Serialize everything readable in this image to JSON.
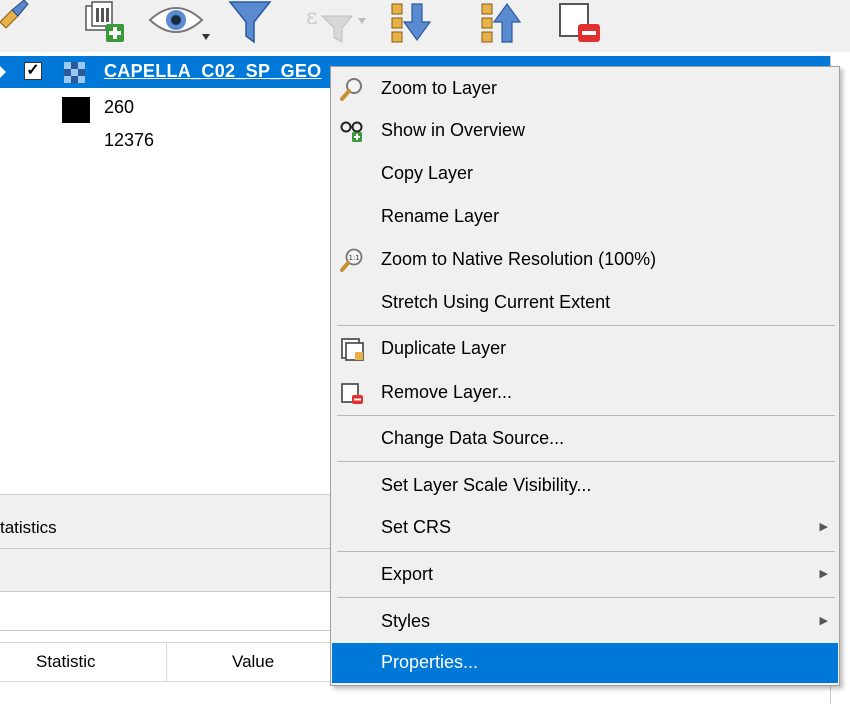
{
  "toolbar": {
    "icons": [
      "style-brush-icon",
      "add-group-icon",
      "visibility-eye-icon",
      "filter-icon",
      "filter-expression-icon",
      "expand-all-icon",
      "collapse-all-icon",
      "remove-layer-icon"
    ]
  },
  "layer_tree": {
    "layer_name": "CAPELLA_C02_SP_GEO",
    "checked": true,
    "checkbox_mark": "✓",
    "legend_max": "260",
    "legend_min": "12376"
  },
  "lower_panel": {
    "tab_label": "tatistics",
    "table_headers": {
      "statistic": "Statistic",
      "value": "Value"
    }
  },
  "context_menu": {
    "items": [
      {
        "label": "Zoom to Layer",
        "icon": "zoom-to-layer-icon"
      },
      {
        "label": "Show in Overview",
        "icon": "overview-glasses-icon"
      },
      {
        "label": "Copy Layer",
        "icon": ""
      },
      {
        "label": "Rename Layer",
        "icon": ""
      },
      {
        "label": "Zoom to Native Resolution (100%)",
        "icon": "zoom-native-icon"
      },
      {
        "label": "Stretch Using Current Extent",
        "icon": ""
      },
      {
        "label": "Duplicate Layer",
        "icon": "duplicate-layer-icon"
      },
      {
        "label": "Remove Layer...",
        "icon": "remove-layer-icon"
      },
      {
        "label": "Change Data Source...",
        "icon": ""
      },
      {
        "label": "Set Layer Scale Visibility...",
        "icon": ""
      },
      {
        "label": "Set CRS",
        "icon": "",
        "submenu": true
      },
      {
        "label": "Export",
        "icon": "",
        "submenu": true
      },
      {
        "label": "Styles",
        "icon": "",
        "submenu": true
      },
      {
        "label": "Properties...",
        "icon": "",
        "selected": true
      }
    ],
    "submenu_arrow": "▶"
  },
  "colors": {
    "selection": "#0078d7",
    "menu_background": "#f0f0f0"
  }
}
